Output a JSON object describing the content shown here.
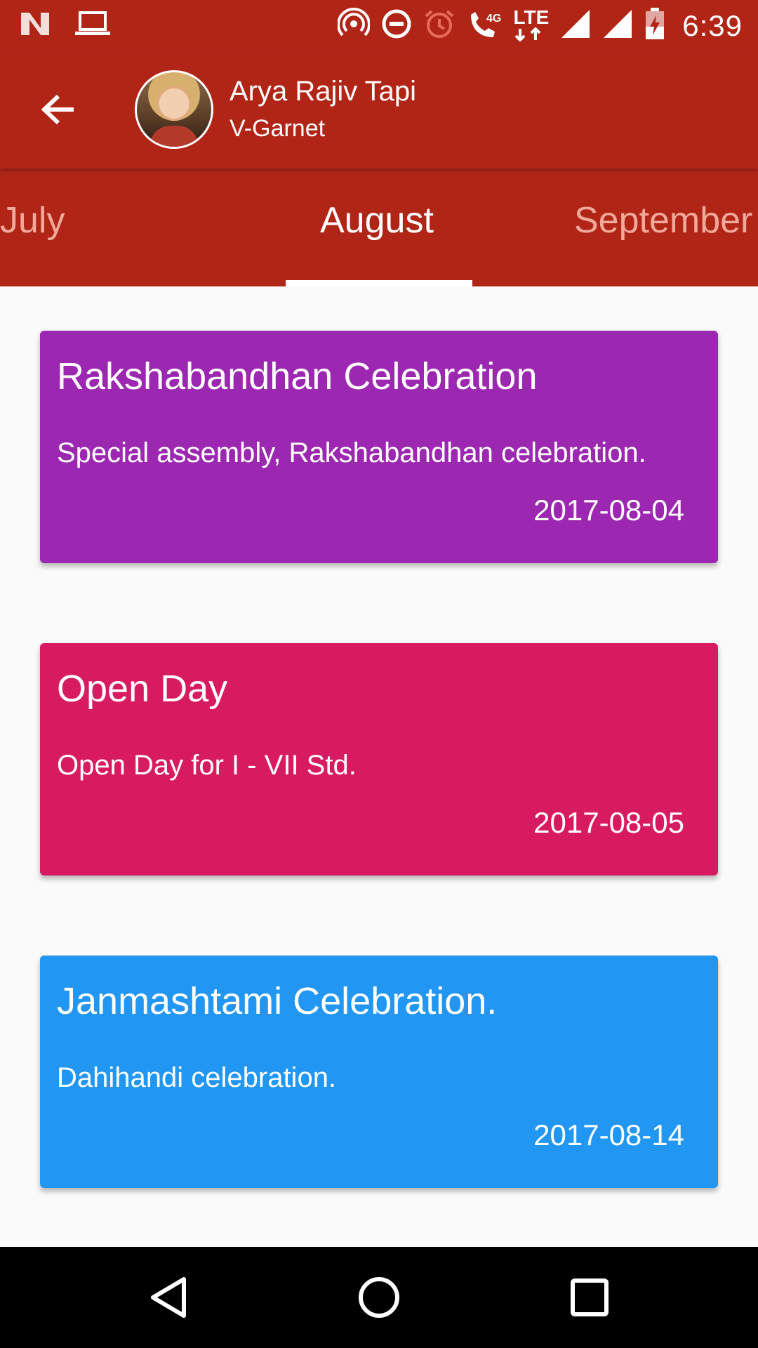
{
  "status_bar": {
    "time": "6:39",
    "network_label": "LTE",
    "network_gen": "4G",
    "icons": [
      "notification-n-icon",
      "laptop-icon",
      "hotspot-icon",
      "do-not-disturb-icon",
      "alarm-icon",
      "wifi-call-icon",
      "lte-icon",
      "signal-icon",
      "signal-icon",
      "battery-charging-icon"
    ]
  },
  "app_bar": {
    "back_icon": "arrow-back-icon",
    "user_name": "Arya Rajiv Tapi",
    "user_class": "V-Garnet"
  },
  "tabs": [
    {
      "label": "July",
      "active": false
    },
    {
      "label": "August",
      "active": true
    },
    {
      "label": "September",
      "active": false
    }
  ],
  "events": [
    {
      "title": "Rakshabandhan Celebration",
      "description": "Special assembly, Rakshabandhan celebration.",
      "date": "2017-08-04",
      "color": "#9c27b0"
    },
    {
      "title": "Open Day",
      "description": "Open Day for I - VII Std.",
      "date": "2017-08-05",
      "color": "#d81b60"
    },
    {
      "title": "Janmashtami Celebration.",
      "description": "Dahihandi celebration.",
      "date": "2017-08-14",
      "color": "#2196f3"
    }
  ],
  "nav_bar": {
    "buttons": [
      "back-triangle-icon",
      "home-circle-icon",
      "recents-square-icon"
    ]
  },
  "colors": {
    "primary": "#b12517",
    "tab_dim_text": "#f0a99a",
    "background": "#fafafa"
  }
}
